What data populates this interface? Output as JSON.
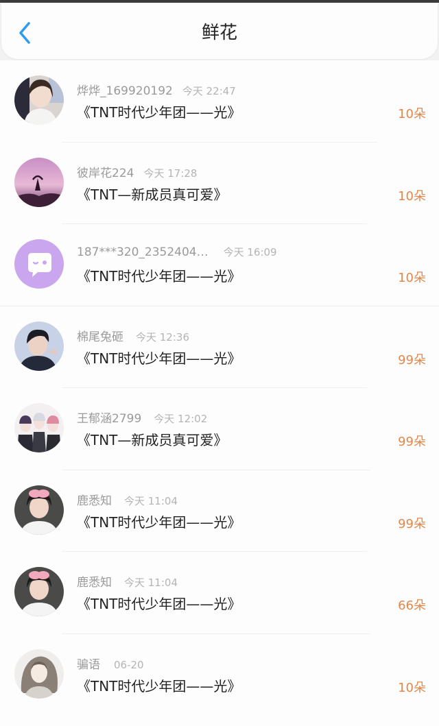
{
  "header": {
    "title": "鲜花",
    "back_icon": "chevron-left-icon",
    "accent_color": "#2f9bec"
  },
  "count_color": "#e2874a",
  "rows": [
    {
      "username": "烨烨_169920192",
      "time": "今天 22:47",
      "work": "《TNT时代少年团——光》",
      "count": "10朵",
      "avatar": "photo-avatar"
    },
    {
      "username": "彼岸花224",
      "time": "今天 17:28",
      "work": "《TNT—新成员真可爱》",
      "count": "10朵",
      "avatar": "photo-avatar"
    },
    {
      "username": "187***320_2352404…",
      "time": "今天 16:09",
      "work": "《TNT时代少年团——光》",
      "count": "10朵",
      "avatar": "default-chat-avatar"
    },
    {
      "username": "棉尾兔砸",
      "time": "今天 12:36",
      "work": "《TNT时代少年团——光》",
      "count": "99朵",
      "avatar": "photo-avatar"
    },
    {
      "username": "王郁涵2799",
      "time": "今天 12:02",
      "work": "《TNT—新成员真可爱》",
      "count": "99朵",
      "avatar": "photo-avatar"
    },
    {
      "username": "鹿悉知",
      "time": "今天 11:04",
      "work": "《TNT时代少年团——光》",
      "count": "99朵",
      "avatar": "photo-avatar"
    },
    {
      "username": "鹿悉知",
      "time": "今天 11:04",
      "work": "《TNT时代少年团——光》",
      "count": "66朵",
      "avatar": "photo-avatar"
    },
    {
      "username": "骗语",
      "time": "06-20",
      "work": "《TNT时代少年团——光》",
      "count": "10朵",
      "avatar": "photo-avatar"
    }
  ]
}
